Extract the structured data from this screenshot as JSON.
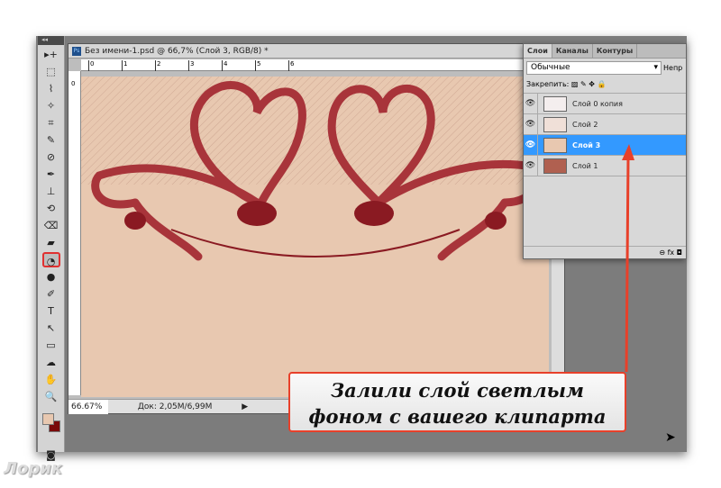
{
  "document": {
    "title": "Без имени-1.psd @ 66,7% (Слой 3, RGB/8) *",
    "ruler_marks": [
      "0",
      "1",
      "2",
      "3",
      "4",
      "5",
      "6"
    ],
    "zoom": "66.67%",
    "doc_size": "Док: 2,05M/6,99M"
  },
  "layers_panel": {
    "tabs": [
      "Слои",
      "Каналы",
      "Контуры"
    ],
    "blend_mode": "Обычные",
    "opacity_label": "Непр",
    "lock_label": "Закрепить:",
    "layers": [
      {
        "name": "Слой 0 копия",
        "active": false
      },
      {
        "name": "Слой 2",
        "active": false
      },
      {
        "name": "Слой 3",
        "active": true
      },
      {
        "name": "Слой 1",
        "active": false
      }
    ],
    "footer_icons": "⊖ fx ◘"
  },
  "tools": [
    "▸+",
    "⬚",
    "⌇",
    "✧",
    "⌗",
    "✎",
    "⊘",
    "✒",
    "⊥",
    "⟲",
    "⌫",
    "▰",
    "◔",
    "●",
    "✐",
    "T",
    "↖",
    "▭",
    "☁",
    "✋",
    "🔍"
  ],
  "colors": {
    "foreground": "#e8c8b0",
    "background": "#7a0a0a",
    "accent": "#e8402a",
    "selection": "#3399ff"
  },
  "callout": {
    "line1": "Залили слой светлым",
    "line2": "фоном с вашего клипарта"
  },
  "watermark": "Лорик"
}
